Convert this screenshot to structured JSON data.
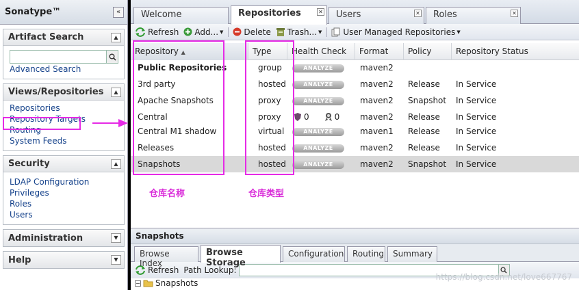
{
  "app": {
    "title": "Sonatype™"
  },
  "sidebar": {
    "artifact_search": {
      "title": "Artifact Search",
      "advanced_link": "Advanced Search"
    },
    "views": {
      "title": "Views/Repositories",
      "items": [
        "Repositories",
        "Repository Targets",
        "Routing",
        "System Feeds"
      ]
    },
    "security": {
      "title": "Security",
      "items": [
        "LDAP Configuration",
        "Privileges",
        "Roles",
        "Users"
      ]
    },
    "administration": {
      "title": "Administration"
    },
    "help": {
      "title": "Help"
    }
  },
  "tabs": [
    "Welcome",
    "Repositories",
    "Users",
    "Roles"
  ],
  "toolbar": {
    "refresh": "Refresh",
    "add": "Add...",
    "delete": "Delete",
    "trash": "Trash...",
    "user_managed": "User Managed Repositories"
  },
  "grid": {
    "columns": [
      "Repository",
      "Type",
      "Health Check",
      "Format",
      "Policy",
      "Repository Status"
    ],
    "rows": [
      {
        "name": "Public Repositories",
        "type": "group",
        "health": "ANALYZE",
        "format": "maven2",
        "policy": "",
        "status": ""
      },
      {
        "name": "3rd party",
        "type": "hosted",
        "health": "ANALYZE",
        "format": "maven2",
        "policy": "Release",
        "status": "In Service"
      },
      {
        "name": "Apache Snapshots",
        "type": "proxy",
        "health": "ANALYZE",
        "format": "maven2",
        "policy": "Snapshot",
        "status": "In Service"
      },
      {
        "name": "Central",
        "type": "proxy",
        "health_a": "0",
        "health_b": "0",
        "format": "maven2",
        "policy": "Release",
        "status": "In Service"
      },
      {
        "name": "Central M1 shadow",
        "type": "virtual",
        "health": "ANALYZE",
        "format": "maven1",
        "policy": "Release",
        "status": "In Service"
      },
      {
        "name": "Releases",
        "type": "hosted",
        "health": "ANALYZE",
        "format": "maven2",
        "policy": "Release",
        "status": "In Service"
      },
      {
        "name": "Snapshots",
        "type": "hosted",
        "health": "ANALYZE",
        "format": "maven2",
        "policy": "Snapshot",
        "status": "In Service"
      }
    ]
  },
  "annotations": {
    "repo_name": "仓库名称",
    "repo_type": "仓库类型"
  },
  "detail": {
    "title": "Snapshots",
    "tabs": [
      "Browse Index",
      "Browse Storage",
      "Configuration",
      "Routing",
      "Summary"
    ],
    "refresh": "Refresh",
    "path_lookup": "Path Lookup:",
    "tree_root": "Snapshots"
  },
  "watermark": "https://blog.csdn.net/love667767",
  "colors": {
    "highlight": "#e62ae6",
    "link": "#15428b",
    "selected_row": "#d9d9d9"
  }
}
